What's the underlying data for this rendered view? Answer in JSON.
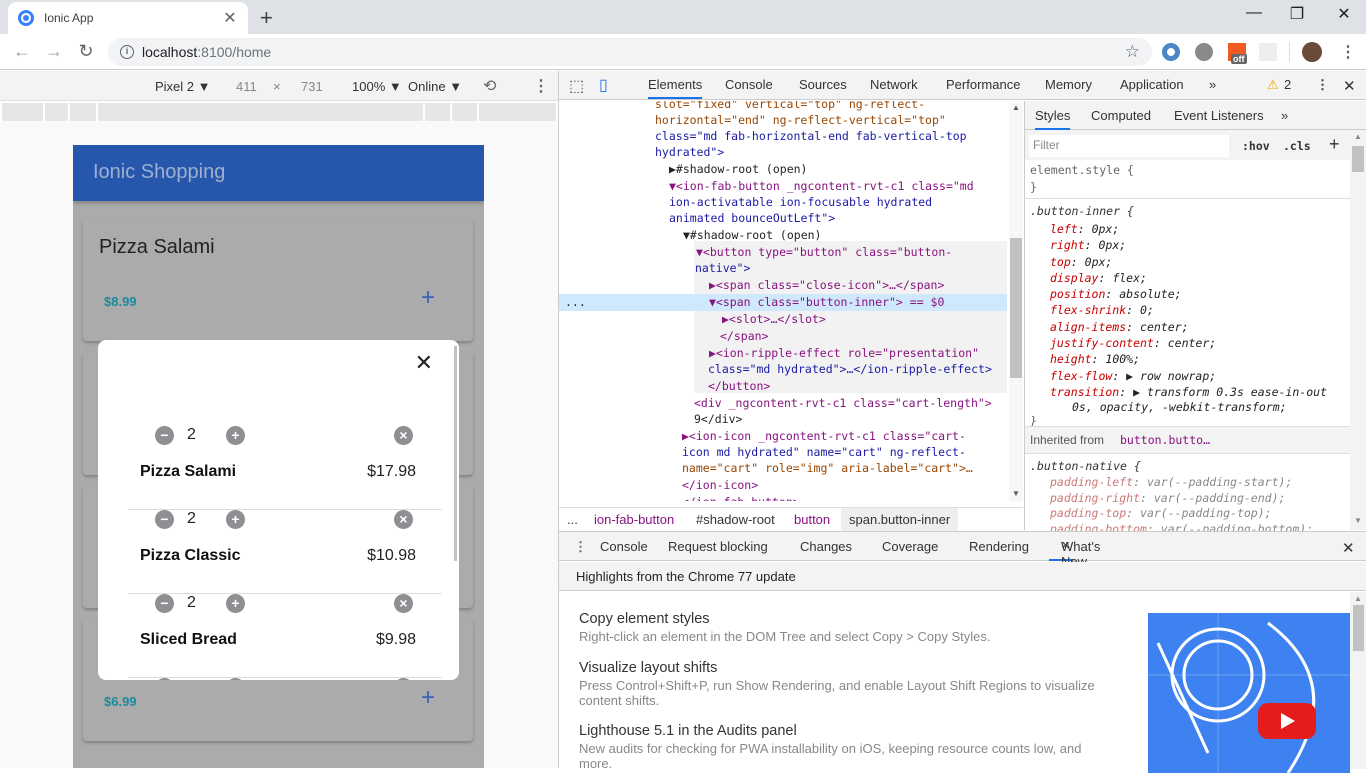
{
  "browser": {
    "tab_title": "Ionic App",
    "new_tab": "+",
    "url_host": "localhost",
    "url_path": ":8100/home",
    "window": {
      "minimize": "—",
      "restore": "❐",
      "close": "✕"
    },
    "extensions": [
      {
        "name": "ext-blue-icon"
      },
      {
        "name": "ext-tomato-icon"
      },
      {
        "name": "ext-com-off-icon",
        "badge": "off"
      },
      {
        "name": "ext-react-icon"
      }
    ]
  },
  "device_toolbar": {
    "device": "Pixel 2 ▼",
    "width": "411",
    "times": "×",
    "height": "731",
    "zoom": "100% ▼",
    "network": "Online ▼"
  },
  "app": {
    "title": "Ionic Shopping",
    "products": [
      {
        "name": "Pizza Salami",
        "price": "$8.99"
      },
      {
        "name": "",
        "price": ""
      },
      {
        "name": "",
        "price": ""
      },
      {
        "name": "",
        "price": "$6.99"
      }
    ],
    "add_icon": "+",
    "cart_modal": {
      "close": "✕",
      "items": [
        {
          "qty": "2",
          "name": "Pizza Salami",
          "total": "$17.98"
        },
        {
          "qty": "2",
          "name": "Pizza Classic",
          "total": "$10.98"
        },
        {
          "qty": "2",
          "name": "Sliced Bread",
          "total": "$9.98"
        }
      ]
    }
  },
  "devtools": {
    "tabs": [
      "Elements",
      "Console",
      "Sources",
      "Network",
      "Performance",
      "Memory",
      "Application"
    ],
    "more_tabs": "»",
    "warnings": "2",
    "elements_lines": [
      "slot=\"fixed\" vertical=\"top\" ng-reflect-",
      "horizontal=\"end\" ng-reflect-vertical=\"top\"",
      "class=\"md fab-horizontal-end fab-vertical-top",
      "hydrated\">",
      "▶#shadow-root (open)",
      "▼<ion-fab-button _ngcontent-rvt-c1 class=\"md",
      "ion-activatable ion-focusable hydrated",
      "animated bounceOutLeft\">",
      "▼#shadow-root (open)",
      "▼<button type=\"button\" class=\"button-",
      "native\">",
      "▶<span class=\"close-icon\">…</span>",
      "▼<span class=\"button-inner\"> == $0",
      "▶<slot>…</slot>",
      "</span>",
      "▶<ion-ripple-effect role=\"presentation\"",
      "class=\"md hydrated\">…</ion-ripple-effect>",
      "</button>",
      "<div _ngcontent-rvt-c1 class=\"cart-length\">",
      "9</div>",
      "▶<ion-icon _ngcontent-rvt-c1 class=\"cart-",
      "icon md hydrated\" name=\"cart\" ng-reflect-",
      "name=\"cart\" role=\"img\" aria-label=\"cart\">…",
      "</ion-icon>",
      "</ion-fab-button>"
    ],
    "selected_marker": "...",
    "breadcrumbs": [
      "...",
      "ion-fab-button",
      "#shadow-root",
      "button",
      "span.button-inner"
    ],
    "styles": {
      "tabs": [
        "Styles",
        "Computed",
        "Event Listeners",
        "»"
      ],
      "filter_placeholder": "Filter",
      "hov": ":hov",
      "cls": ".cls",
      "plus": "+",
      "element_style": "element.style {",
      "close_brace": "}",
      "rule_selector": ".button-inner {",
      "rule_props": [
        {
          "p": "left",
          "v": "0px;"
        },
        {
          "p": "right",
          "v": "0px;"
        },
        {
          "p": "top",
          "v": "0px;"
        },
        {
          "p": "display",
          "v": "flex;"
        },
        {
          "p": "position",
          "v": "absolute;"
        },
        {
          "p": "flex-shrink",
          "v": "0;"
        },
        {
          "p": "align-items",
          "v": "center;"
        },
        {
          "p": "justify-content",
          "v": "center;"
        },
        {
          "p": "height",
          "v": "100%;"
        },
        {
          "p": "flex-flow",
          "v": "▶ row nowrap;"
        },
        {
          "p": "transition",
          "v": "▶ transform 0.3s ease-in-out"
        }
      ],
      "transition_cont": "0s, opacity, -webkit-transform;",
      "inherited_label": "Inherited from ",
      "inherited_from": "button.butto…",
      "native_selector": ".button-native {",
      "native_props": [
        {
          "p": "padding-left",
          "v": "var(--padding-start);"
        },
        {
          "p": "padding-right",
          "v": "var(--padding-end);"
        },
        {
          "p": "padding-top",
          "v": "var(--padding-top);"
        },
        {
          "p": "padding-bottom",
          "v": "var(--padding-bottom);"
        }
      ]
    },
    "drawer": {
      "tabs": [
        "Console",
        "Request blocking",
        "Changes",
        "Coverage",
        "Rendering",
        "What's New"
      ],
      "active_tab_close": "✕",
      "close": "✕",
      "highlight": "Highlights from the Chrome 77 update",
      "news": [
        {
          "title": "Copy element styles",
          "desc": "Right-click an element in the DOM Tree and select Copy > Copy Styles."
        },
        {
          "title": "Visualize layout shifts",
          "desc": "Press Control+Shift+P, run Show Rendering, and enable Layout Shift Regions to visualize content shifts."
        },
        {
          "title": "Lighthouse 5.1 in the Audits panel",
          "desc": "New audits for checking for PWA installability on iOS, keeping resource counts low, and more."
        }
      ]
    }
  }
}
